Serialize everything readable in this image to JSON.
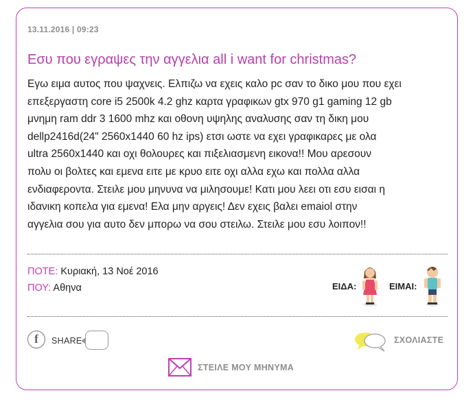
{
  "post": {
    "date": "13.11.2016 | 09:23",
    "title": "Εσυ που εγραψες την αγγελια all i want for christmas?",
    "body_lines": [
      "Εγω ειμα αυτος που ψαχνεις. Ελπιζω να εχεις καλο pc σαν το δικο μου που εχει",
      "επεξεργαστη core i5 2500k 4.2 ghz καρτα γραφικων gtx 970 g1 gaming 12 gb",
      "μνημη ram ddr 3 1600 mhz και οθονη υψηλης αναλυσης σαν τη δικη μου",
      "dellp2416d(24\" 2560x1440 60 hz ips) ετσι ωστε να εχει γραφικαρες με ολα",
      "ultra 2560x1440 και οχι θολουρες και πιξελιασμενη εικονα!! Μου αρεσουν",
      "πολυ οι βολτες και εμενα ειτε με κρυο ειτε οχι αλλα εχω και πολλα αλλα",
      "ενδιαφεροντα. Στειλε μου μηνυνα να μιλησουμε! Κατι μου λεει οτι εσυ εισαι η",
      "ιδανικη κοπελα για εμενα! Ελα μην αργεις! Δεν εχεις βαλει emaiol στην",
      "αγγελια σου για αυτο δεν μπορω να σου στειλω. Στειλε μου εσυ λοιπον!!"
    ],
    "when_label": "ΠΟΤΕ:",
    "when_value": "Κυριακή, 13 Νοέ 2016",
    "where_label": "ΠΟΥ:",
    "where_value": "Αθηνα",
    "seen_label": "ΕΙΔΑ:",
    "iam_label": "ΕΙΜΑΙ:"
  },
  "actions": {
    "share_icon_glyph": "f",
    "share_label": "SHARE",
    "comment_label": "ΣΧΟΛΙΑΣΤΕ",
    "message_label": "ΣΤΕΙΛΕ ΜΟΥ ΜΗΝΥΜΑ"
  },
  "colors": {
    "accent": "#c03fb4",
    "title": "#b640ad",
    "muted": "#8d8d8d",
    "comment_icon": "#f2ea55"
  },
  "icons": {
    "seen": "girl-figure-icon",
    "iam": "boy-figure-icon",
    "share": "facebook-icon",
    "comment": "speech-bubbles-icon",
    "message": "envelope-icon"
  }
}
